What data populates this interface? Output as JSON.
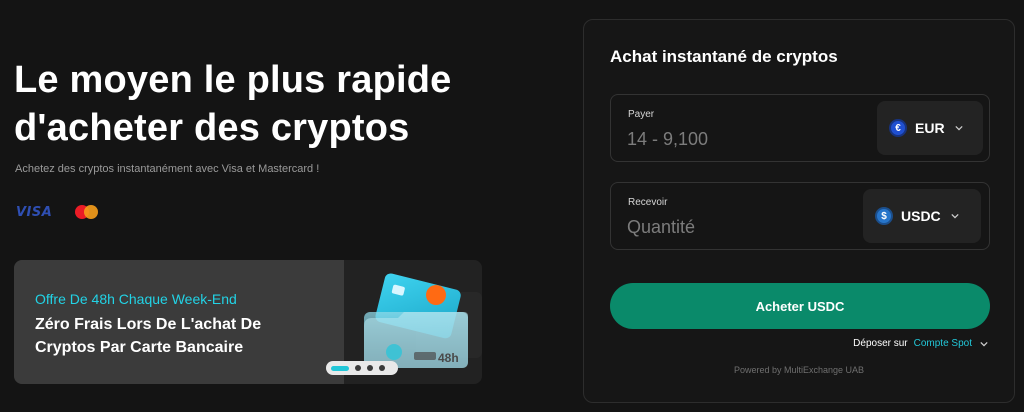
{
  "hero": {
    "title_line1": "Le moyen le plus rapide",
    "title_line2": "d'acheter des cryptos",
    "subtitle": "Achetez des cryptos instantanément avec Visa et Mastercard !",
    "payment_logos": [
      "VISA",
      "mastercard"
    ]
  },
  "promo": {
    "kicker": "Offre De 48h Chaque Week-End",
    "title_line1": "Zéro Frais Lors De L'achat De",
    "title_line2": "Cryptos Par Carte Bancaire",
    "badge": "48h",
    "slides": 4,
    "active_slide": 1
  },
  "widget": {
    "title": "Achat instantané de cryptos",
    "pay": {
      "label": "Payer",
      "placeholder": "14 - 9,100",
      "currency": "EUR",
      "currency_icon": "euro-coin-icon"
    },
    "receive": {
      "label": "Recevoir",
      "placeholder": "Quantité",
      "currency": "USDC",
      "currency_icon": "usdc-coin-icon"
    },
    "buy_label": "Acheter USDC",
    "deposit_label": "Déposer sur",
    "deposit_target": "Compte Spot",
    "powered_by": "Powered by MultiExchange UAB"
  },
  "colors": {
    "background": "#141414",
    "accent": "#0a8a6a",
    "cyan": "#22c7d8",
    "promo_kicker": "#22d3e6"
  }
}
